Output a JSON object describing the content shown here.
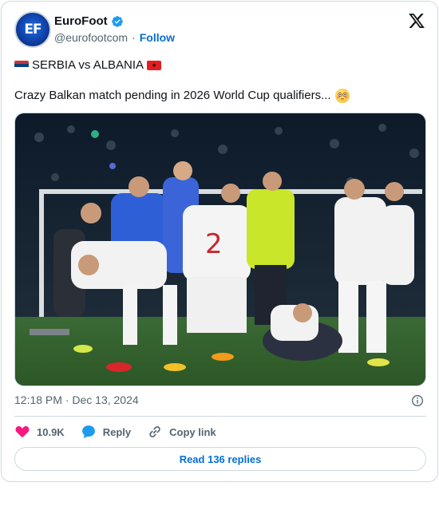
{
  "author": {
    "display_name": "EuroFoot",
    "handle": "@eurofootcom",
    "follow_label": "Follow",
    "avatar_text": "EF",
    "verified": true
  },
  "tweet": {
    "line1": "SERBIA vs ALBANIA",
    "line2": "Crazy Balkan match pending in 2026 World Cup qualifiers...",
    "flag_left": "serbia-flag",
    "flag_right": "albania-flag",
    "emoji_end": "flushed-face-emoji",
    "image_alt": "Players from Serbia and Albania brawling on the pitch with a steward"
  },
  "meta": {
    "timestamp": "12:18 PM · Dec 13, 2024"
  },
  "actions": {
    "likes": "10.9K",
    "reply_label": "Reply",
    "copy_label": "Copy link"
  },
  "footer": {
    "read_replies_label": "Read 136 replies"
  },
  "colors": {
    "link_blue": "#006fd6",
    "like_pink": "#f91880",
    "border": "#cfd9de",
    "muted": "#536471"
  }
}
